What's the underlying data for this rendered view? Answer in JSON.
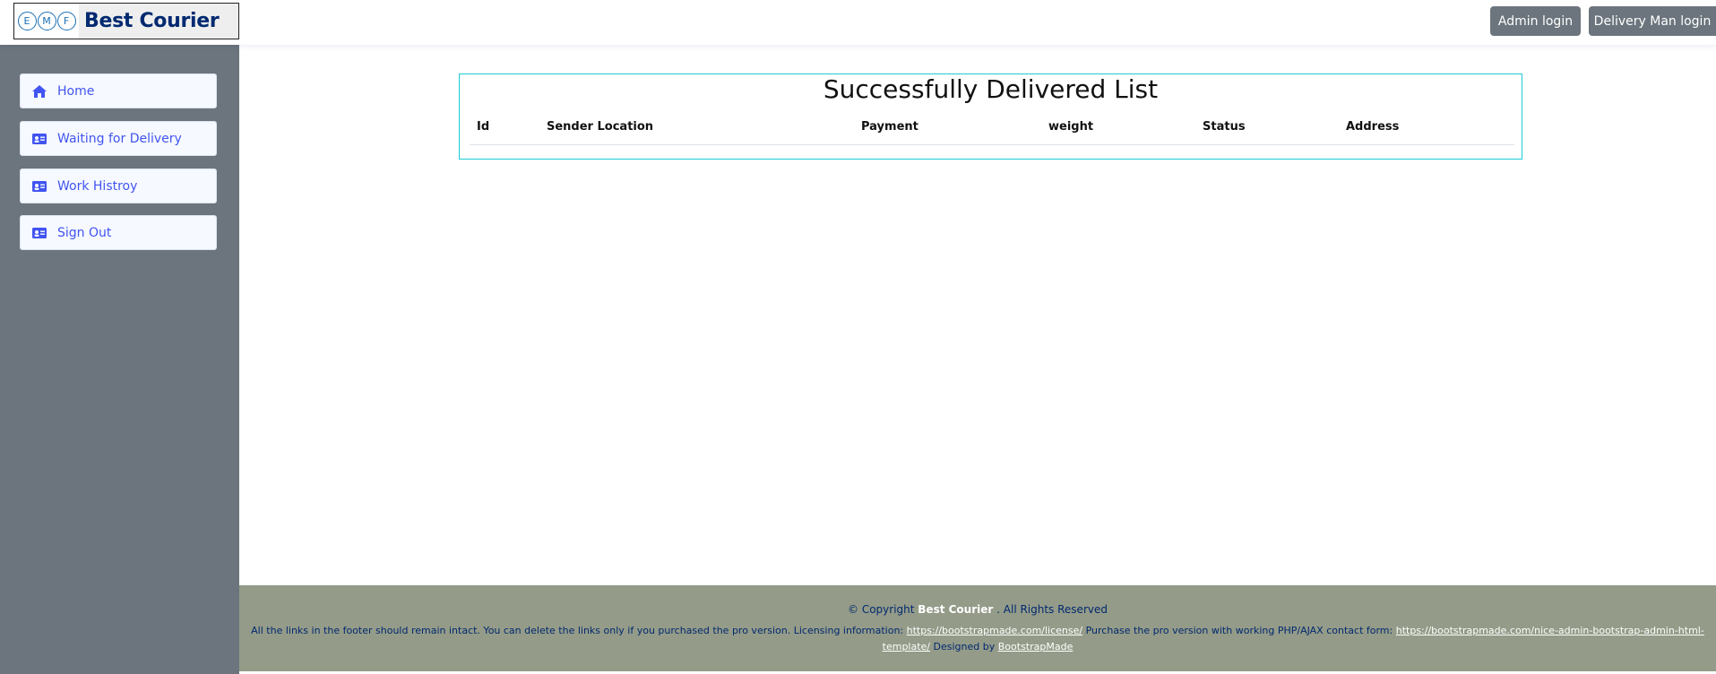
{
  "header": {
    "logo_letters": [
      "E",
      "M",
      "F"
    ],
    "brand": "Best Courier",
    "buttons": {
      "admin_login": "Admin login",
      "delivery_man_login": "Delivery Man login"
    }
  },
  "sidebar": {
    "items": [
      {
        "label": "Home",
        "icon": "house-icon"
      },
      {
        "label": "Waiting for Delivery",
        "icon": "id-card-icon"
      },
      {
        "label": "Work Histroy",
        "icon": "id-card-icon"
      },
      {
        "label": "Sign Out",
        "icon": "id-card-icon"
      }
    ]
  },
  "main": {
    "title": "Successfully Delivered List",
    "columns": [
      "Id",
      "Sender Location",
      "Payment",
      "weight",
      "Status",
      "Address"
    ],
    "rows": []
  },
  "footer": {
    "copyright_prefix": "© Copyright",
    "brand": "Best Courier",
    "rights": ". All Rights Reserved",
    "credits_text_1": "All the links in the footer should remain intact. You can delete the links only if you purchased the pro version. Licensing information:",
    "license_link": "https://bootstrapmade.com/license/",
    "credits_text_2": "Purchase the pro version with working PHP/AJAX contact form:",
    "template_link": "https://bootstrapmade.com/nice-admin-bootstrap-admin-html-template/",
    "credits_text_3": "Designed by",
    "designer_link": "BootstrapMade"
  },
  "colors": {
    "sidebar_bg": "#6c757d",
    "sidebar_link": "#4154f1",
    "card_border": "#1ccbd6",
    "footer_bg": "#949b88",
    "brand_text": "#012970",
    "header_button_bg": "#6c757d"
  }
}
